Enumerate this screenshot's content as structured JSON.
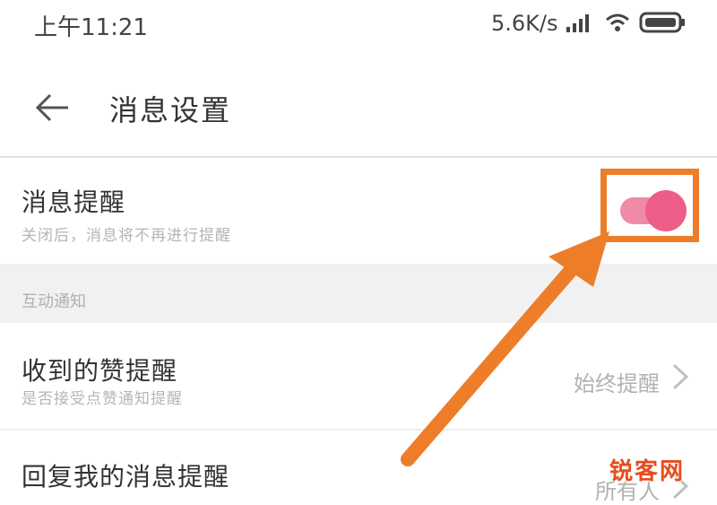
{
  "status_bar": {
    "time": "上午11:21",
    "net_speed": "5.6K/s"
  },
  "header": {
    "title": "消息设置"
  },
  "message_reminder": {
    "title": "消息提醒",
    "subtitle": "关闭后，消息将不再进行提醒",
    "toggle_on": true,
    "toggle_color": "#ee5d87"
  },
  "sections": [
    {
      "label": "互动通知",
      "rows": [
        {
          "title": "收到的赞提醒",
          "subtitle": "是否接受点赞通知提醒",
          "value": "始终提醒"
        },
        {
          "title": "回复我的消息提醒",
          "value": "所有人"
        }
      ]
    }
  ],
  "annotation": {
    "highlight_color": "#ee7d2a"
  },
  "watermark": "锐客网"
}
